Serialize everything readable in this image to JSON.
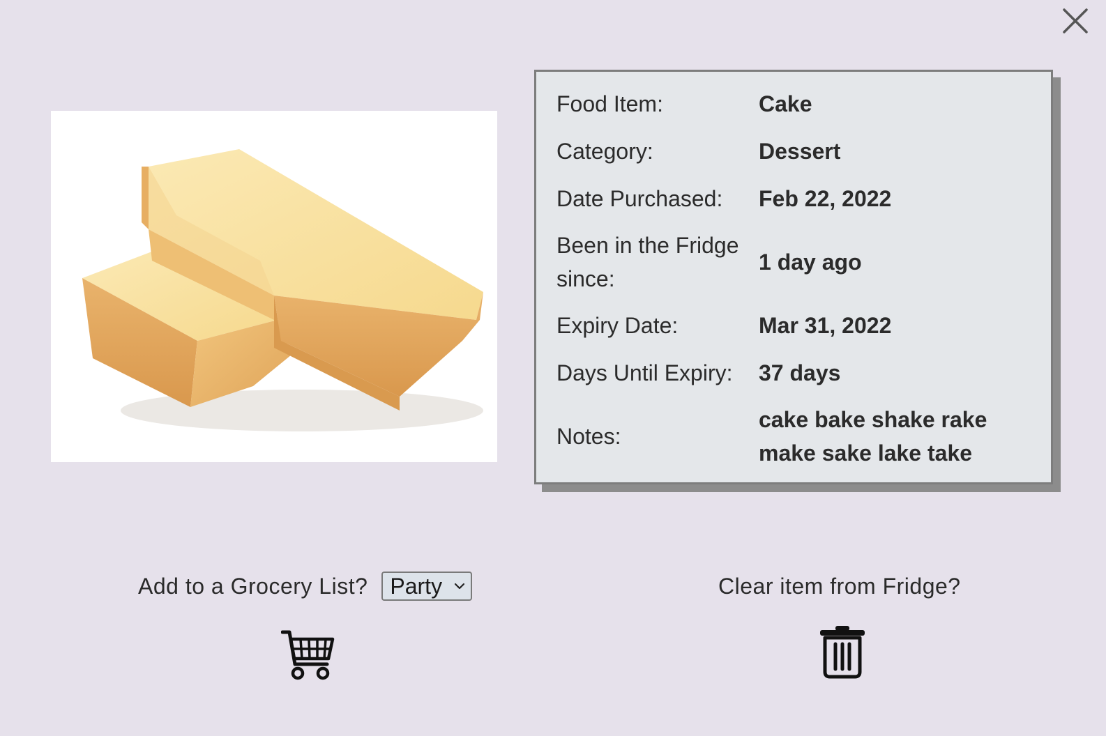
{
  "close": {
    "icon": "close-icon"
  },
  "image": {
    "icon": "cake-photo"
  },
  "details": [
    {
      "label": "Food Item:",
      "value": "Cake"
    },
    {
      "label": "Category:",
      "value": "Dessert"
    },
    {
      "label": "Date Purchased:",
      "value": "Feb 22, 2022"
    },
    {
      "label": "Been in the Fridge since:",
      "value": "1 day ago"
    },
    {
      "label": "Expiry Date:",
      "value": "Mar 31, 2022"
    },
    {
      "label": "Days Until Expiry:",
      "value": "37 days"
    },
    {
      "label": "Notes:",
      "value": "cake bake shake rake make sake lake take"
    }
  ],
  "grocery": {
    "prompt": "Add to a Grocery List?",
    "selected_list": "Party",
    "icon": "shopping-cart-icon"
  },
  "clear": {
    "prompt": "Clear item from Fridge?",
    "icon": "trash-icon"
  },
  "colors": {
    "background": "#e6e1eb",
    "card_background": "#e4e7ea",
    "card_border": "#7d7d7d",
    "select_background": "#dde3ea"
  }
}
